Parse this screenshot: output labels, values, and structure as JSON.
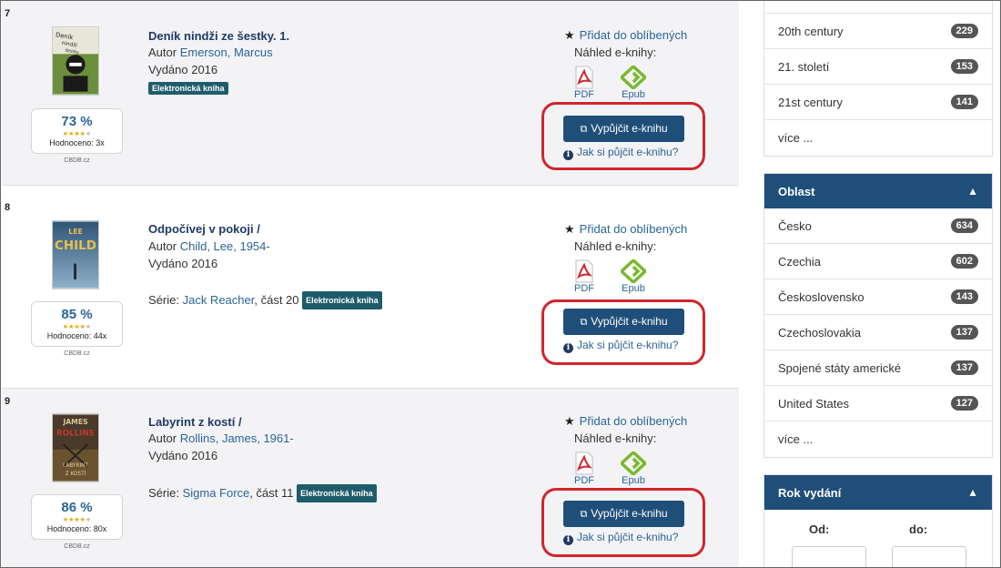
{
  "results": [
    {
      "number": "7",
      "title": "Deník nindži ze šestky. 1.",
      "author_prefix": "Autor",
      "author": "Emerson, Marcus",
      "published": "Vydáno 2016",
      "series_prefix": "",
      "series": "",
      "badge": "Elektronická kniha",
      "rating_pct": "73 %",
      "rating_stars": 4,
      "rating_count": "Hodnoceno: 3x",
      "rating_source": "CBDB.cz",
      "cover_text": "Deník nindži ze šestky",
      "cover_colors": [
        "#6b8f3c",
        "#1a1a1a"
      ]
    },
    {
      "number": "8",
      "title": "Odpočívej v pokoji /",
      "author_prefix": "Autor",
      "author": "Child, Lee, 1954-",
      "published": "Vydáno 2016",
      "series_prefix": "Série:",
      "series": "Jack Reacher",
      "series_part": ", část 20",
      "badge": "Elektronická kniha",
      "rating_pct": "85 %",
      "rating_stars": 4,
      "rating_count": "Hodnoceno: 44x",
      "rating_source": "CBDB.cz",
      "cover_text": "LEE CHILD",
      "cover_colors": [
        "#2f5577",
        "#7a9bb5"
      ]
    },
    {
      "number": "9",
      "title": "Labyrint z kostí /",
      "author_prefix": "Autor",
      "author": "Rollins, James, 1961-",
      "published": "Vydáno 2016",
      "series_prefix": "Série:",
      "series": "Sigma Force",
      "series_part": ", část 11",
      "badge": "Elektronická kniha",
      "rating_pct": "86 %",
      "rating_stars": 4,
      "rating_count": "Hodnoceno: 80x",
      "rating_source": "CBDB.cz",
      "cover_text": "JAMES ROLLINS",
      "cover_colors": [
        "#4a3a2a",
        "#b89a5a"
      ]
    }
  ],
  "actions": {
    "favorite": "Přidat do oblíbených",
    "preview": "Náhled e-knihy:",
    "pdf": "PDF",
    "epub": "Epub",
    "borrow": "Vypůjčit e-knihu",
    "howto": "Jak si půjčit e-knihu?"
  },
  "sidebar": {
    "subject_items": [
      {
        "label": "20th century",
        "count": "229"
      },
      {
        "label": "21. století",
        "count": "153"
      },
      {
        "label": "21st century",
        "count": "141"
      }
    ],
    "subject_more": "více ...",
    "area": {
      "title": "Oblast",
      "items": [
        {
          "label": "Česko",
          "count": "634"
        },
        {
          "label": "Czechia",
          "count": "602"
        },
        {
          "label": "Československo",
          "count": "143"
        },
        {
          "label": "Czechoslovakia",
          "count": "137"
        },
        {
          "label": "Spojené státy americké",
          "count": "137"
        },
        {
          "label": "United States",
          "count": "127"
        }
      ],
      "more": "více ..."
    },
    "year": {
      "title": "Rok vydání",
      "from": "Od:",
      "to": "do:"
    }
  },
  "colors": {
    "primary": "#1f4e79",
    "link": "#2a6496",
    "badge": "#1f5c6b",
    "highlight": "#d0262c",
    "star": "#f0a500"
  }
}
